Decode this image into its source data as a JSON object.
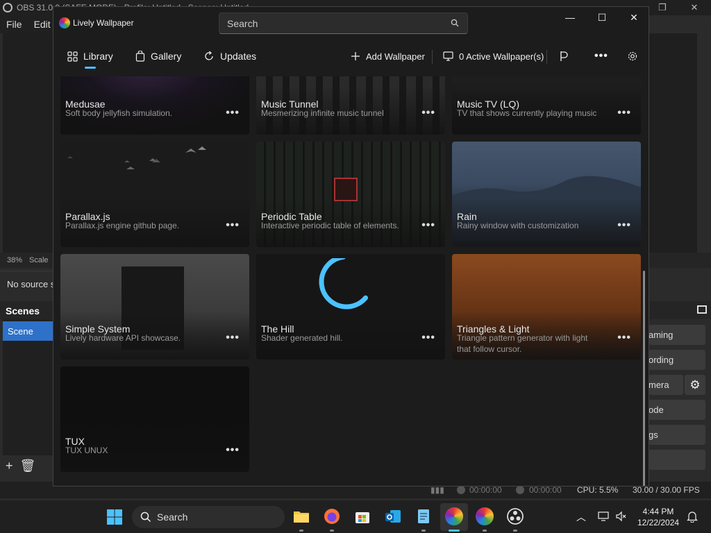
{
  "obs": {
    "title": "OBS 31.0.0 (SAFE MODE) - Profile: Untitled - Scenes: Untitled",
    "menu": [
      "File",
      "Edit"
    ],
    "zoom": "38%",
    "scale_label": "Scale",
    "no_source": "No source s",
    "scenes_header": "Scenes",
    "scene_item": "Scene",
    "controls": [
      "aming",
      "ording",
      "mera",
      "ode",
      "gs"
    ],
    "status": {
      "stream_time": "00:00:00",
      "record_time": "00:00:00",
      "cpu": "CPU: 5.5%",
      "fps": "30.00 / 30.00 FPS"
    }
  },
  "lively": {
    "title": "Lively Wallpaper",
    "search_placeholder": "Search",
    "nav": {
      "library": "Library",
      "gallery": "Gallery",
      "updates": "Updates",
      "add_wallpaper": "Add Wallpaper",
      "active_wallpapers": "0 Active Wallpaper(s)"
    },
    "cards": [
      {
        "title": "Medusae",
        "desc": "Soft body jellyfish simulation."
      },
      {
        "title": "Music Tunnel",
        "desc": "Mesmerizing infinite music tunnel"
      },
      {
        "title": "Music TV (LQ)",
        "desc": "TV that shows currently playing music"
      },
      {
        "title": "Parallax.js",
        "desc": "Parallax.js engine github page."
      },
      {
        "title": "Periodic Table",
        "desc": "Interactive periodic table of elements."
      },
      {
        "title": "Rain",
        "desc": "Rainy window with customization"
      },
      {
        "title": "Simple System",
        "desc": "Lively hardware API showcase."
      },
      {
        "title": "The Hill",
        "desc": "Shader generated hill."
      },
      {
        "title": "Triangles & Light",
        "desc": "Triangle pattern generator with light that follow cursor."
      },
      {
        "title": "TUX",
        "desc": "TUX UNUX"
      }
    ],
    "more_label": "•••"
  },
  "taskbar": {
    "search_label": "Search",
    "time": "4:44 PM",
    "date": "12/22/2024"
  },
  "colors": {
    "accent": "#4cc2ff",
    "obs_selection": "#2e71c8"
  }
}
